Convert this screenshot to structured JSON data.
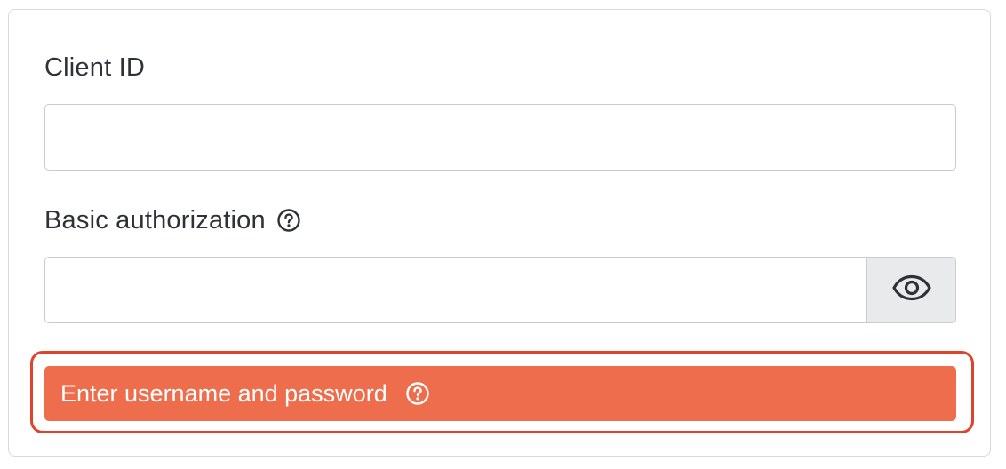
{
  "form": {
    "client_id": {
      "label": "Client ID",
      "value": "",
      "placeholder": ""
    },
    "basic_authorization": {
      "label": "Basic authorization",
      "value": "",
      "placeholder": "",
      "help_icon": "question-circle-icon",
      "toggle_icon": "eye-icon"
    },
    "error": {
      "message": "Enter username and password",
      "help_icon": "question-circle-icon"
    }
  },
  "colors": {
    "error_background": "#ed6d4c",
    "error_outline": "#e0432b",
    "text": "#2f3235",
    "border": "#c9ccd0"
  }
}
